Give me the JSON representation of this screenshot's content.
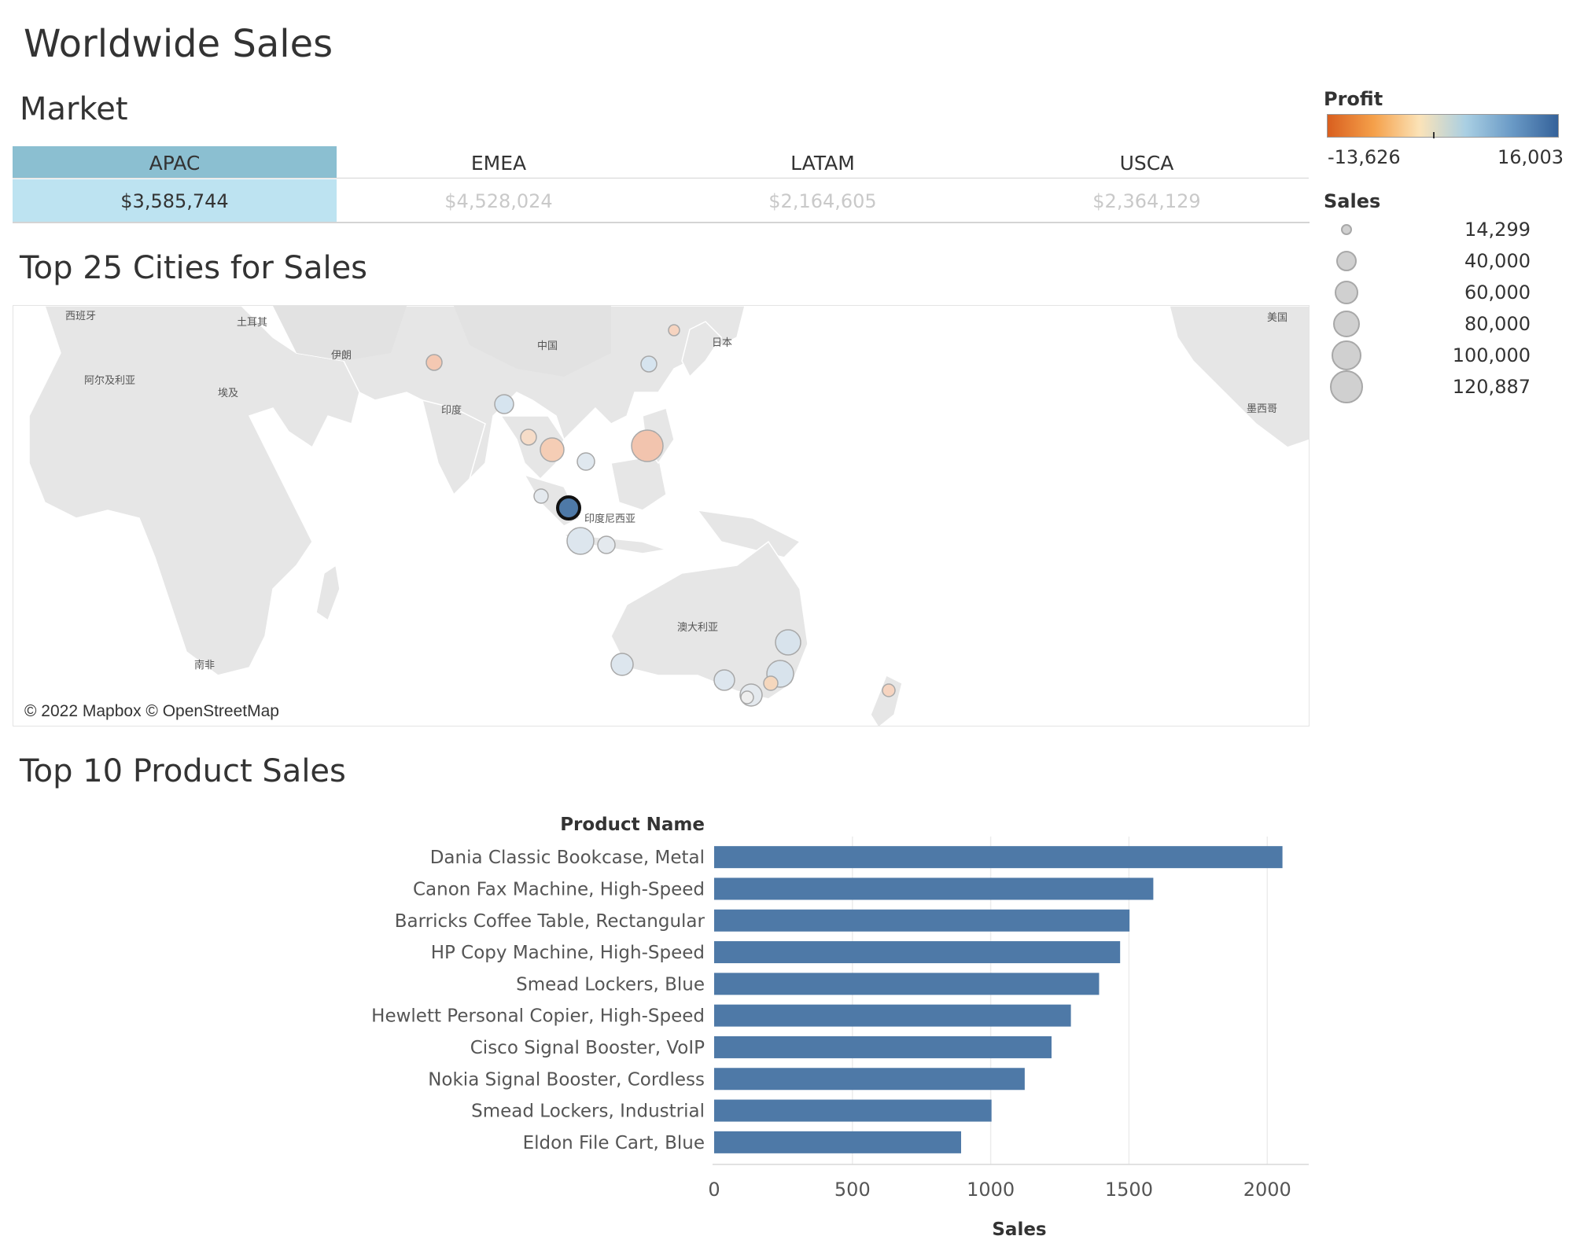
{
  "page_title": "Worldwide Sales",
  "market": {
    "title": "Market",
    "columns": [
      {
        "name": "APAC",
        "value": "$3,585,744",
        "selected": true
      },
      {
        "name": "EMEA",
        "value": "$4,528,024",
        "selected": false
      },
      {
        "name": "LATAM",
        "value": "$2,164,605",
        "selected": false
      },
      {
        "name": "USCA",
        "value": "$2,364,129",
        "selected": false
      }
    ]
  },
  "legends": {
    "profit_title": "Profit",
    "profit_min": "-13,626",
    "profit_max": "16,003",
    "profit_colors": [
      "#d95f1f",
      "#f5a04a",
      "#fbe3b8",
      "#a9cfe3",
      "#6a9ac6",
      "#35629a"
    ],
    "sales_title": "Sales",
    "sales_sizes": [
      "14,299",
      "40,000",
      "60,000",
      "80,000",
      "100,000",
      "120,887"
    ]
  },
  "map": {
    "title": "Top 25 Cities for Sales",
    "attribution": "© 2022 Mapbox © OpenStreetMap",
    "labels": {
      "spain": "西班牙",
      "turkey": "土耳其",
      "iran": "伊朗",
      "china": "中国",
      "japan": "日本",
      "usa": "美国",
      "algeria": "阿尔及利亚",
      "egypt": "埃及",
      "india": "印度",
      "mexico": "墨西哥",
      "indonesia": "印度尼西亚",
      "australia": "澳大利亚",
      "south_africa": "南非"
    }
  },
  "chart_data": {
    "type": "bar",
    "title": "Top 10 Product Sales",
    "orientation": "horizontal",
    "ylabel": "Product Name",
    "xlabel": "Sales",
    "xlim": [
      0,
      2150
    ],
    "xticks": [
      0,
      500,
      1000,
      1500,
      2000
    ],
    "categories": [
      "Dania Classic Bookcase, Metal",
      "Canon Fax Machine, High-Speed",
      "Barricks Coffee Table, Rectangular",
      "HP Copy Machine, High-Speed",
      "Smead Lockers, Blue",
      "Hewlett Personal Copier, High-Speed",
      "Cisco Signal Booster, VoIP",
      "Nokia Signal Booster, Cordless",
      "Smead Lockers, Industrial",
      "Eldon File Cart, Blue"
    ],
    "values": [
      2055,
      1588,
      1502,
      1468,
      1392,
      1290,
      1220,
      1123,
      1003,
      893
    ],
    "bar_color": "#4e79a7",
    "grid": true
  }
}
